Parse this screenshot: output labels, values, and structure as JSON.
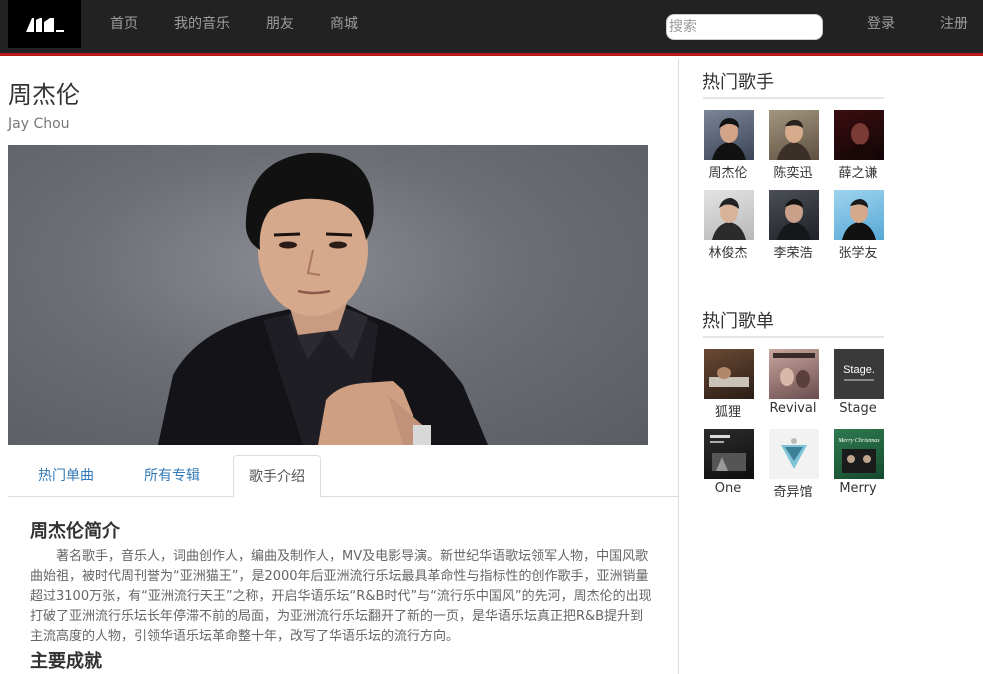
{
  "nav": {
    "links": [
      "首页",
      "我的音乐",
      "朋友",
      "商城"
    ],
    "search_placeholder": "搜索",
    "login": "登录",
    "register": "注册",
    "accent_color": "#b81a1a"
  },
  "artist": {
    "name": "周杰伦",
    "name_en": "Jay Chou"
  },
  "tabs": [
    "热门单曲",
    "所有专辑",
    "歌手介绍"
  ],
  "active_tab": "歌手介绍",
  "bio": {
    "title": "周杰伦简介",
    "text": "著名歌手，音乐人，词曲创作人，编曲及制作人，MV及电影导演。新世纪华语歌坛领军人物，中国风歌曲始祖，被时代周刊誉为“亚洲猫王”，是2000年后亚洲流行乐坛最具革命性与指标性的创作歌手，亚洲销量超过3100万张，有“亚洲流行天王”之称，开启华语乐坛“R&B时代”与“流行乐中国风”的先河，周杰伦的出现打破了亚洲流行乐坛长年停滞不前的局面，为亚洲流行乐坛翻开了新的一页，是华语乐坛真正把R&B提升到主流高度的人物，引领华语乐坛革命整十年，改写了华语乐坛的流行方向。",
    "achievements_title": "主要成就"
  },
  "sidebar": {
    "hot_singers_title": "热门歌手",
    "singers": [
      "周杰伦",
      "陈奕迅",
      "薛之谦",
      "林俊杰",
      "李荣浩",
      "张学友"
    ],
    "hot_playlists_title": "热门歌单",
    "playlists": [
      "狐狸",
      "Revival",
      "Stage",
      "One",
      "奇异馆",
      "Merry"
    ],
    "playlist_cover_text": {
      "stage": "Stage.",
      "merry": "Merry Christmas"
    }
  }
}
